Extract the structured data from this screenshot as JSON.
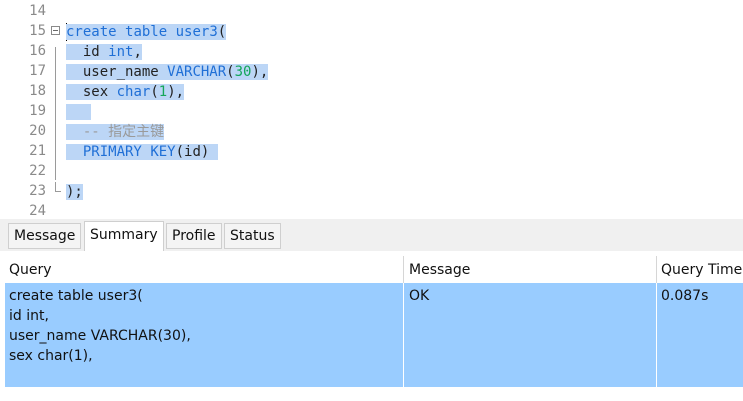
{
  "editor": {
    "lines": [
      {
        "n": "14"
      },
      {
        "n": "15",
        "code": "create table user3("
      },
      {
        "n": "16",
        "code": "  id int,"
      },
      {
        "n": "17",
        "code": "  user_name VARCHAR(30),"
      },
      {
        "n": "18",
        "code": "  sex char(1),"
      },
      {
        "n": "19"
      },
      {
        "n": "20",
        "code": "  -- 指定主键"
      },
      {
        "n": "21",
        "code": "  PRIMARY KEY(id)"
      },
      {
        "n": "22"
      },
      {
        "n": "23",
        "code": ");"
      },
      {
        "n": "24"
      }
    ],
    "colors": {
      "keyword": "#1f6fd6",
      "number": "#14a65a",
      "comment": "#9a9a9a",
      "selection": "#bcd6f6"
    }
  },
  "tabs": [
    "Message",
    "Summary",
    "Profile",
    "Status"
  ],
  "active_tab": "Summary",
  "result": {
    "columns": [
      "Query",
      "Message",
      "Query Time"
    ],
    "row": {
      "query_lines": [
        "create table user3(",
        "id int,",
        "user_name VARCHAR(30),",
        "sex char(1),"
      ],
      "message": "OK",
      "query_time": "0.087s"
    },
    "selection_color": "#99ccff"
  }
}
